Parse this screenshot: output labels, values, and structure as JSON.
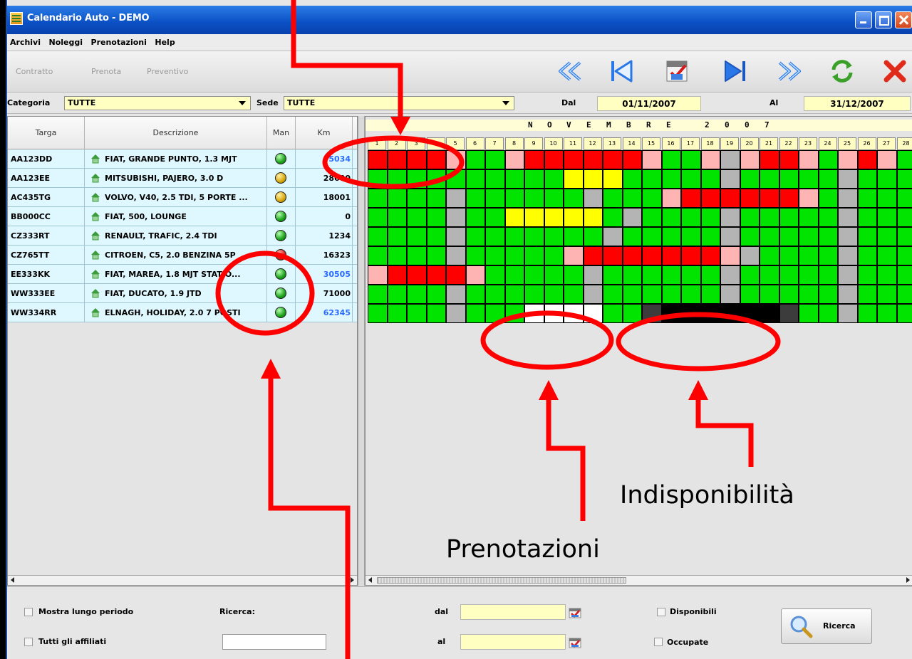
{
  "window": {
    "title": "Calendario Auto - DEMO"
  },
  "menu": [
    "Archivi",
    "Noleggi",
    "Prenotazioni",
    "Help"
  ],
  "toolbar": {
    "text_buttons": [
      "Contratto",
      "Prenota",
      "Preventivo"
    ],
    "icons": [
      "fast-back-icon",
      "back-icon",
      "calendar-check-icon",
      "forward-icon",
      "fast-forward-icon",
      "refresh-icon",
      "close-icon"
    ]
  },
  "filters": {
    "categoria_label": "Categoria",
    "categoria_value": "TUTTE",
    "sede_label": "Sede",
    "sede_value": "TUTTE",
    "dal_label": "Dal",
    "dal_value": "01/11/2007",
    "al_label": "Al",
    "al_value": "31/12/2007"
  },
  "table": {
    "columns": [
      "Targa",
      "Descrizione",
      "Man",
      "Km"
    ],
    "rows": [
      {
        "targa": "AA123DD",
        "descrizione": "FIAT, GRANDE PUNTO, 1.3 MJT",
        "man": "green",
        "km": "5034",
        "km_blue": true
      },
      {
        "targa": "AA123EE",
        "descrizione": "MITSUBISHI, PAJERO, 3.0 D",
        "man": "yellow",
        "km": "28600",
        "km_blue": false
      },
      {
        "targa": "AC435TG",
        "descrizione": "VOLVO, V40, 2.5 TDI, 5 PORTE ...",
        "man": "yellow",
        "km": "18001",
        "km_blue": false
      },
      {
        "targa": "BB000CC",
        "descrizione": "FIAT, 500, LOUNGE",
        "man": "green",
        "km": "0",
        "km_blue": false
      },
      {
        "targa": "CZ333RT",
        "descrizione": "RENAULT, TRAFIC, 2.4 TDI",
        "man": "green",
        "km": "1234",
        "km_blue": false
      },
      {
        "targa": "CZ765TT",
        "descrizione": "CITROEN, C5, 2.0 BENZINA 5P",
        "man": "red",
        "km": "16323",
        "km_blue": false
      },
      {
        "targa": "EE333KK",
        "descrizione": "FIAT, MAREA, 1.8 MJT STATIO...",
        "man": "green",
        "km": "30505",
        "km_blue": true
      },
      {
        "targa": "WW333EE",
        "descrizione": "FIAT, DUCATO, 1.9 JTD",
        "man": "green",
        "km": "71000",
        "km_blue": false
      },
      {
        "targa": "WW334RR",
        "descrizione": "ELNAGH, HOLIDAY, 2.0 7 POSTI",
        "man": "green",
        "km": "62345",
        "km_blue": true
      }
    ]
  },
  "calendar": {
    "month_header": [
      "N",
      "O",
      "V",
      "E",
      "M",
      "B",
      "R",
      "E",
      "2",
      "0",
      "0",
      "7"
    ],
    "days": [
      "1",
      "2",
      "3",
      "4",
      "5",
      "6",
      "7",
      "8",
      "9",
      "10",
      "11",
      "12",
      "13",
      "14",
      "15",
      "16",
      "17",
      "18",
      "19",
      "20",
      "21",
      "22",
      "23",
      "24",
      "25",
      "26",
      "27",
      "28"
    ],
    "legend": {
      "G": "#00e400",
      "R": "#ff0000",
      "P": "#ffb4b4",
      "Y": "#ffff00",
      "A": "#b4b4b4",
      "W": "#ffffff",
      "K": "#000000",
      "D": "#3c3c3c"
    },
    "grid": [
      "RRRRPGGPRRRRRRPGGPAPRRPGPRPG",
      "GGGGGGGGGGYYYGGGGGAGGGGGAGGG",
      "GGGGAGGGGGGAGGGPRRRRRRPGAGGG",
      "GGGGAGGYYYYYGAGGGGAGGGGGAGGG",
      "GGGGAGGGGGGGAGGGGGAGGGGGAGGG",
      "GGGGAGGGGGPRRRRRRRPAGGGGAGGG",
      "PRRRRPGGGGGAGGGGGGAGGGGGAGGG",
      "GGGGAGGGGGGAGGGGGGAGGGGGAGGG",
      "GGGGAGGGWWWWGGDKKKKKKDGGAGGG"
    ]
  },
  "bottom": {
    "mostra_lungo_periodo": "Mostra lungo periodo",
    "tutti_gli_affiliati": "Tutti gli affiliati",
    "ricerca_label": "Ricerca:",
    "dal_label": "dal",
    "al_label": "al",
    "disponibili": "Disponibili",
    "occupate": "Occupate",
    "ricerca_button": "Ricerca"
  },
  "annotations": {
    "indisponibilita": "Indisponibilità",
    "prenotazioni": "Prenotazioni"
  }
}
